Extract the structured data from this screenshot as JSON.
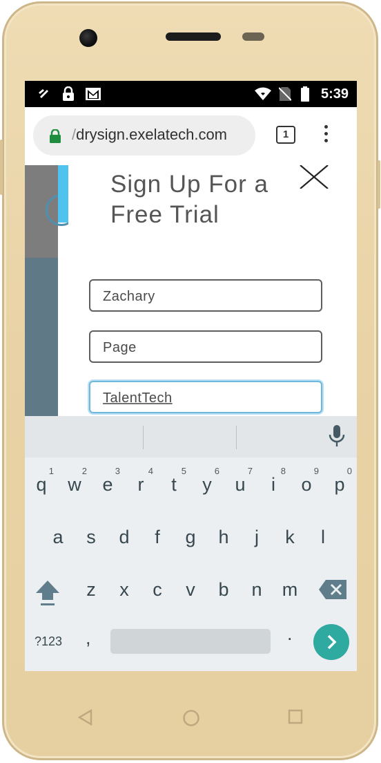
{
  "status_bar": {
    "time": "5:39",
    "icons": [
      "data-saver-icon",
      "lock-icon",
      "gmail-icon",
      "wifi-icon",
      "no-sim-icon",
      "battery-icon"
    ]
  },
  "browser": {
    "url_scheme": "/",
    "url_host": "drysign.exelatech.com",
    "tab_count": "1",
    "icons": [
      "secure-lock-icon",
      "tab-switcher-icon",
      "overflow-menu-icon"
    ]
  },
  "modal": {
    "title": "Sign Up For a Free Trial",
    "fields": [
      {
        "value": "Zachary"
      },
      {
        "value": "Page"
      },
      {
        "value": "TalentTech"
      }
    ],
    "colors": {
      "accent": "#4fc2ee",
      "focus_border": "#6fb8dc"
    }
  },
  "keyboard": {
    "row1": [
      {
        "key": "q",
        "hint": "1"
      },
      {
        "key": "w",
        "hint": "2"
      },
      {
        "key": "e",
        "hint": "3"
      },
      {
        "key": "r",
        "hint": "4"
      },
      {
        "key": "t",
        "hint": "5"
      },
      {
        "key": "y",
        "hint": "6"
      },
      {
        "key": "u",
        "hint": "7"
      },
      {
        "key": "i",
        "hint": "8"
      },
      {
        "key": "o",
        "hint": "9"
      },
      {
        "key": "p",
        "hint": "0"
      }
    ],
    "row2": [
      "a",
      "s",
      "d",
      "f",
      "g",
      "h",
      "j",
      "k",
      "l"
    ],
    "row3": [
      "z",
      "x",
      "c",
      "v",
      "b",
      "n",
      "m"
    ],
    "symbols_label": "?123",
    "comma": ",",
    "period": ".",
    "colors": {
      "background": "#eceff1",
      "go_button": "#2eaaa0"
    }
  },
  "device": {
    "color": "#e9d3a6",
    "nav_icons": [
      "back-icon",
      "home-icon",
      "recents-icon"
    ]
  }
}
